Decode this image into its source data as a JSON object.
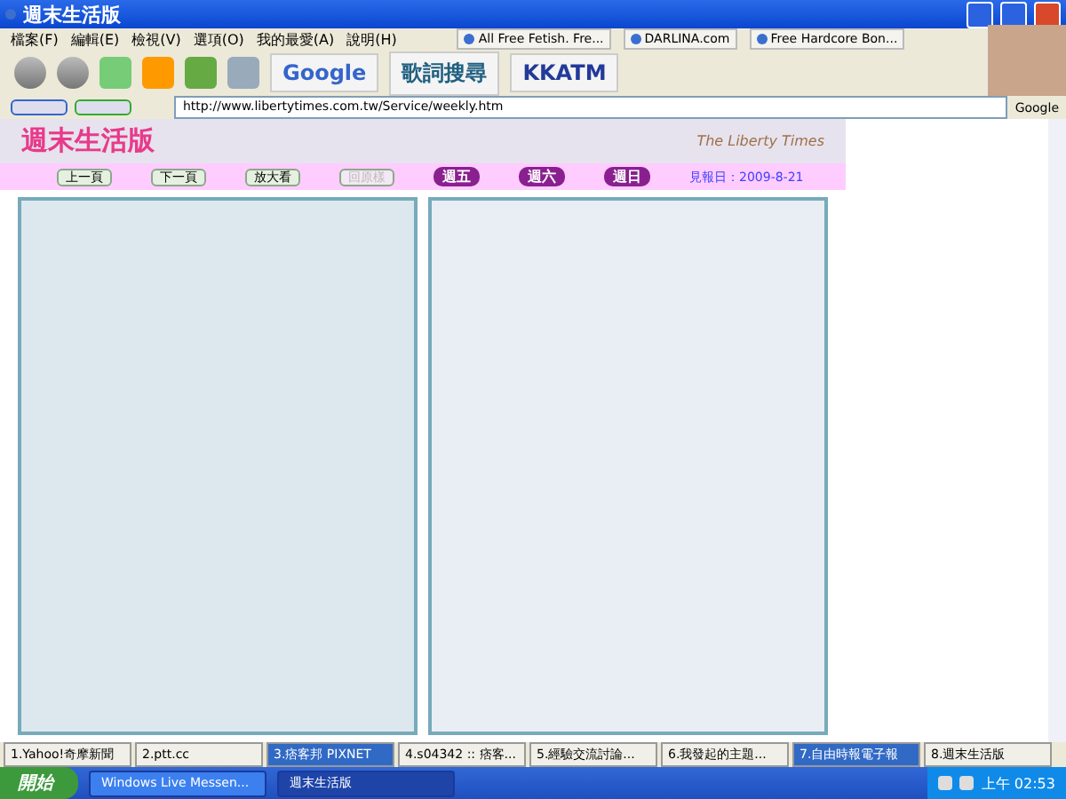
{
  "window": {
    "title": "週末生活版"
  },
  "menu": [
    "檔案(F)",
    "編輯(E)",
    "檢視(V)",
    "選項(O)",
    "我的最愛(A)",
    "說明(H)"
  ],
  "links": [
    "All Free Fetish. Fre...",
    "DARLINA.com",
    "Free Hardcore Bon..."
  ],
  "toolbar_logos": [
    "Google",
    "歌詞搜尋",
    "KKATM"
  ],
  "address": {
    "value": "http://www.libertytimes.com.tw/Service/weekly.htm",
    "search_engine": "Google"
  },
  "banner": {
    "title": "週末生活版",
    "subtitle": "The Liberty Times"
  },
  "nav": {
    "buttons": [
      {
        "label": "上一頁",
        "disabled": false
      },
      {
        "label": "下一頁",
        "disabled": false
      },
      {
        "label": "放大看",
        "disabled": false
      },
      {
        "label": "回原樣",
        "disabled": true
      }
    ],
    "days": [
      "週五",
      "週六",
      "週日"
    ],
    "date": "見報日：2009-8-21"
  },
  "browser_tabs": [
    {
      "label": "1.Yahoo!奇摩新聞",
      "selected": false
    },
    {
      "label": "2.ptt.cc",
      "selected": false
    },
    {
      "label": "3.痞客邦 PIXNET",
      "selected": true
    },
    {
      "label": "4.s04342 :: 痞客...",
      "selected": false
    },
    {
      "label": "5.經驗交流討論...",
      "selected": false
    },
    {
      "label": "6.我發起的主題...",
      "selected": false
    },
    {
      "label": "7.自由時報電子報",
      "selected": true
    },
    {
      "label": "8.週末生活版",
      "selected": false
    }
  ],
  "taskbar": {
    "start": "開始",
    "windows": [
      {
        "label": "Windows Live Messen...",
        "selected": false
      },
      {
        "label": "週末生活版",
        "selected": true
      }
    ],
    "clock": "上午 02:53"
  }
}
